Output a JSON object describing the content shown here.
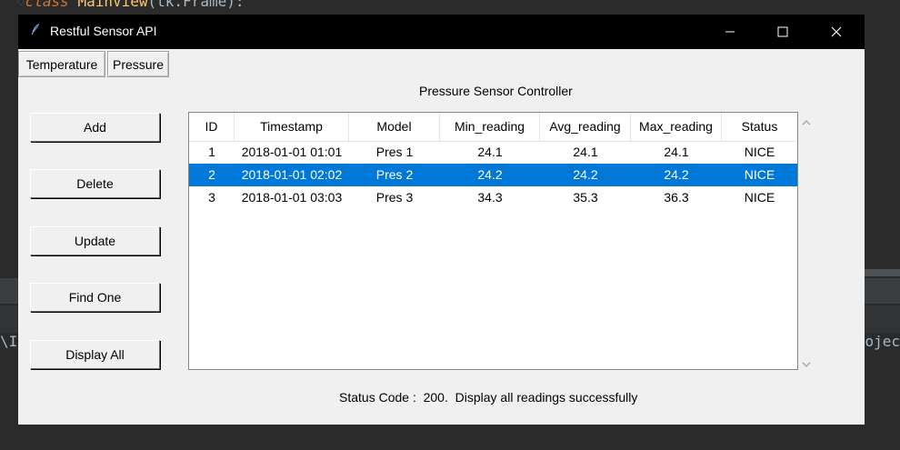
{
  "ide": {
    "code_keyword": "class",
    "code_class": "MainView",
    "code_rest": "(tk.Frame):",
    "left_fragment": "\\I",
    "right_fragment": "ojec"
  },
  "window": {
    "title": "Restful Sensor API",
    "controls": {
      "minimize": "—",
      "maximize": "☐",
      "close": "✕"
    }
  },
  "tabs": [
    {
      "label": "Temperature"
    },
    {
      "label": "Pressure"
    }
  ],
  "content_title": "Pressure Sensor Controller",
  "buttons": {
    "add": "Add",
    "delete": "Delete",
    "update": "Update",
    "find_one": "Find One",
    "display_all": "Display All"
  },
  "table": {
    "columns": [
      "ID",
      "Timestamp",
      "Model",
      "Min_reading",
      "Avg_reading",
      "Max_reading",
      "Status"
    ],
    "rows": [
      {
        "id": "1",
        "timestamp": "2018-01-01 01:01",
        "model": "Pres 1",
        "min": "24.1",
        "avg": "24.1",
        "max": "24.1",
        "status": "NICE"
      },
      {
        "id": "2",
        "timestamp": "2018-01-01 02:02",
        "model": "Pres 2",
        "min": "24.2",
        "avg": "24.2",
        "max": "24.2",
        "status": "NICE"
      },
      {
        "id": "3",
        "timestamp": "2018-01-01 03:03",
        "model": "Pres 3",
        "min": "34.3",
        "avg": "35.3",
        "max": "36.3",
        "status": "NICE"
      }
    ],
    "selected_row": 1
  },
  "status": {
    "label": "Status Code :",
    "code": "200.",
    "message": "Display all readings successfully"
  },
  "colors": {
    "selection": "#0078d7",
    "window_bg": "#f0f0f0",
    "titlebar": "#000000"
  }
}
